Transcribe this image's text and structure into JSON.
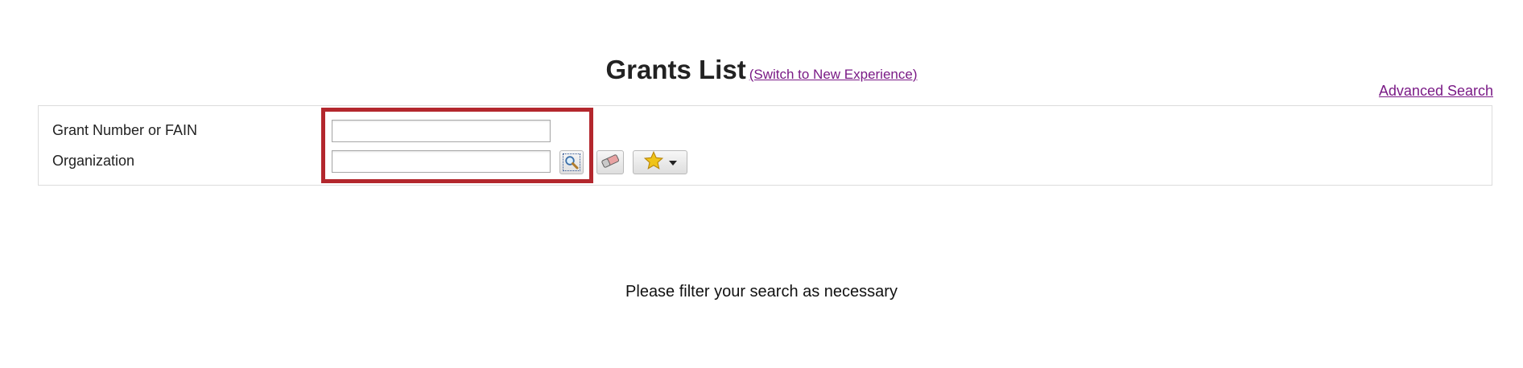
{
  "header": {
    "title": "Grants List",
    "switch_link": "(Switch to New Experience)",
    "advanced_search": "Advanced Search"
  },
  "filters": {
    "grant_number_label": "Grant Number or FAIN",
    "grant_number_value": "",
    "organization_label": "Organization",
    "organization_value": ""
  },
  "toolbar": {
    "lookup_icon": "magnifier-icon",
    "clear_icon": "eraser-icon",
    "favorites_icon": "star-icon",
    "favorites_dropdown_icon": "caret-down-icon"
  },
  "message": "Please filter your search as necessary",
  "colors": {
    "link": "#7a1a86",
    "highlight": "#b3272d",
    "star": "#f0c419"
  }
}
